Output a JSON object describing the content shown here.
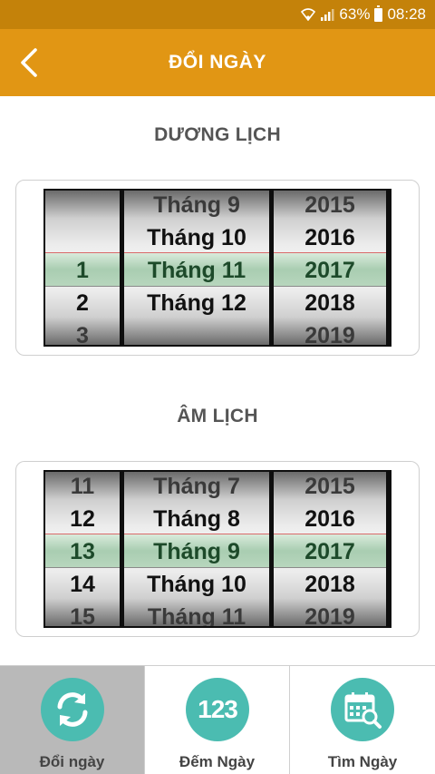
{
  "status_bar": {
    "battery": "63%",
    "time": "08:28"
  },
  "app_bar": {
    "title": "ĐỔI NGÀY"
  },
  "solar": {
    "title": "DƯƠNG LỊCH",
    "days": [
      "",
      "",
      "1",
      "2",
      "3"
    ],
    "months": [
      "Tháng 9",
      "Tháng 10",
      "Tháng 11",
      "Tháng 12",
      ""
    ],
    "years": [
      "2015",
      "2016",
      "2017",
      "2018",
      "2019"
    ]
  },
  "lunar": {
    "title": "ÂM LỊCH",
    "days": [
      "11",
      "12",
      "13",
      "14",
      "15"
    ],
    "months": [
      "Tháng 7",
      "Tháng 8",
      "Tháng 9",
      "Tháng 10",
      "Tháng 11"
    ],
    "years": [
      "2015",
      "2016",
      "2017",
      "2018",
      "2019"
    ]
  },
  "nav": {
    "items": [
      {
        "label": "Đổi ngày",
        "icon": "convert-arrows-icon"
      },
      {
        "label": "Đếm Ngày",
        "icon": "count-123-icon"
      },
      {
        "label": "Tìm Ngày",
        "icon": "calendar-search-icon"
      }
    ],
    "count_icon_text": "123"
  },
  "colors": {
    "status_bar": "#c4820a",
    "app_bar": "#e19614",
    "accent": "#4bbcb1"
  }
}
